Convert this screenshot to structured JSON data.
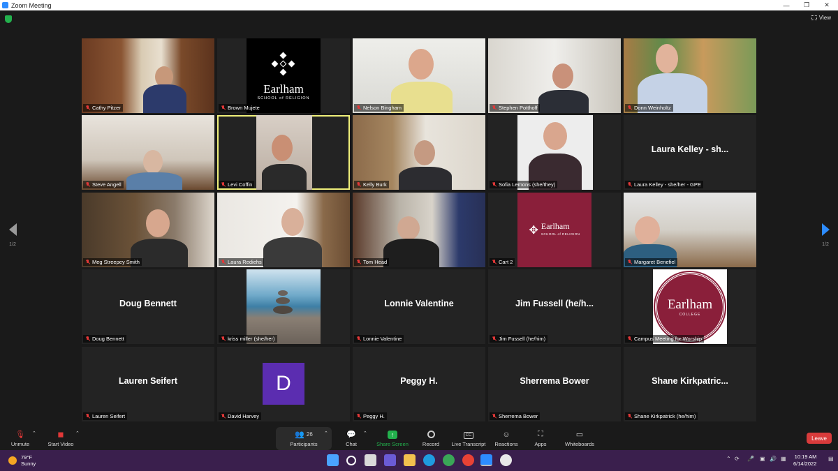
{
  "window": {
    "title": "Zoom Meeting",
    "controls": [
      "—",
      "❐",
      "✕"
    ]
  },
  "meeting": {
    "view_label": "View",
    "page_indicator_left": "1/2",
    "page_indicator_right": "1/2"
  },
  "tiles": [
    {
      "name": "Cathy Pitzer"
    },
    {
      "name": "Brown Mujete",
      "logo_text": "Earlham",
      "logo_sub": "SCHOOL of RELIGION"
    },
    {
      "name": "Nelson Bingham"
    },
    {
      "name": "Stephen Potthoff"
    },
    {
      "name": "Donn Weinholtz"
    },
    {
      "name": "Steve Angell"
    },
    {
      "name": "Levi Coffin"
    },
    {
      "name": "Kelly Burk"
    },
    {
      "name": "Sofia Lemons (she/they)"
    },
    {
      "name": "Laura Kelley - she/her - GPE",
      "big": "Laura Kelley - sh..."
    },
    {
      "name": "Meg Streepey Smith"
    },
    {
      "name": "Laura Rediehs"
    },
    {
      "name": "Tom Head"
    },
    {
      "name": "Cart 2",
      "logo_text": "Earlham",
      "logo_sub": "SCHOOL of RELIGION"
    },
    {
      "name": "Margaret Benefiel"
    },
    {
      "name": "Doug Bennett",
      "big": "Doug Bennett"
    },
    {
      "name": "kriss miller (she/her)"
    },
    {
      "name": "Lonnie Valentine",
      "big": "Lonnie Valentine"
    },
    {
      "name": "Jim Fussell (he/him)",
      "big": "Jim Fussell (he/h..."
    },
    {
      "name": "Campus Meeting for Worship",
      "logo_text": "Earlham",
      "logo_sub": "COLLEGE"
    },
    {
      "name": "Lauren Seifert",
      "big": "Lauren Seifert"
    },
    {
      "name": "David Harvey",
      "avatar_letter": "D"
    },
    {
      "name": "Peggy H.",
      "big": "Peggy H."
    },
    {
      "name": "Sherrema Bower",
      "big": "Sherrema Bower"
    },
    {
      "name": "Shane Kirkpatrick (he/him)",
      "big": "Shane  Kirkpatric..."
    }
  ],
  "toolbar": {
    "unmute": "Unmute",
    "start_video": "Start Video",
    "participants": "Participants",
    "participants_count": "26",
    "chat": "Chat",
    "share_screen": "Share Screen",
    "record": "Record",
    "live_transcript": "Live Transcript",
    "cc": "CC",
    "reactions": "Reactions",
    "apps": "Apps",
    "whiteboards": "Whiteboards",
    "leave": "Leave",
    "colors": {
      "share": "#23b14d",
      "leave": "#d83b3b",
      "mute": "#e23838",
      "accent": "#2d8cff"
    }
  },
  "taskbar": {
    "temperature": "79°F",
    "condition": "Sunny",
    "time": "10:19 AM",
    "date": "6/14/2022"
  }
}
